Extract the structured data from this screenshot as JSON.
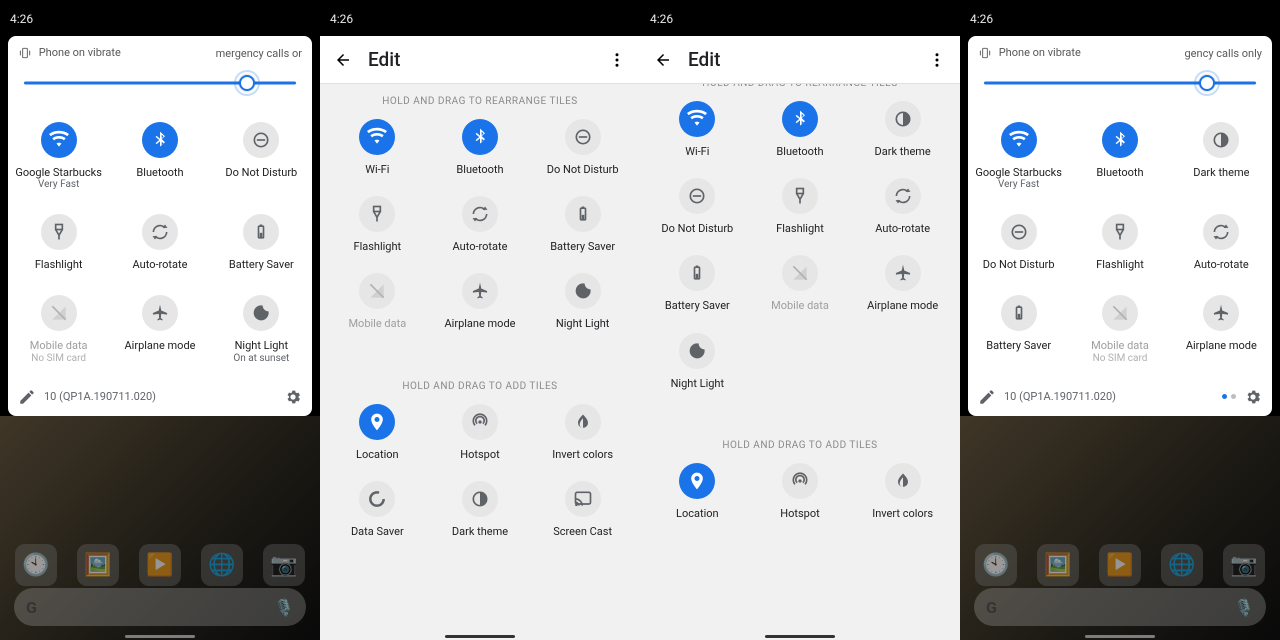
{
  "time": "4:26",
  "status": {
    "vibrate": "Phone on vibrate",
    "emergency1": "mergency calls or",
    "emergency4": "gency calls only"
  },
  "brightness_pct1": 82,
  "brightness_pct4": 82,
  "footer": {
    "build": "10 (QP1A.190711.020)"
  },
  "panel1_tiles": [
    {
      "id": "wifi",
      "label": "Google Starbucks",
      "sub": "Very Fast",
      "state": "on"
    },
    {
      "id": "bt",
      "label": "Bluetooth",
      "state": "on"
    },
    {
      "id": "dnd",
      "label": "Do Not Disturb",
      "state": "off"
    },
    {
      "id": "flash",
      "label": "Flashlight",
      "state": "off"
    },
    {
      "id": "rotate",
      "label": "Auto-rotate",
      "state": "off"
    },
    {
      "id": "battery",
      "label": "Battery Saver",
      "state": "off"
    },
    {
      "id": "mobile",
      "label": "Mobile data",
      "sub": "No SIM card",
      "state": "dis"
    },
    {
      "id": "airplane",
      "label": "Airplane mode",
      "state": "off"
    },
    {
      "id": "night",
      "label": "Night Light",
      "sub": "On at sunset",
      "state": "off"
    }
  ],
  "panel4_tiles": [
    {
      "id": "wifi",
      "label": "Google Starbucks",
      "sub": "Very Fast",
      "state": "on"
    },
    {
      "id": "bt",
      "label": "Bluetooth",
      "state": "on"
    },
    {
      "id": "dark",
      "label": "Dark theme",
      "state": "off"
    },
    {
      "id": "dnd",
      "label": "Do Not Disturb",
      "state": "off"
    },
    {
      "id": "flash",
      "label": "Flashlight",
      "state": "off"
    },
    {
      "id": "rotate",
      "label": "Auto-rotate",
      "state": "off"
    },
    {
      "id": "battery",
      "label": "Battery Saver",
      "state": "off"
    },
    {
      "id": "mobile",
      "label": "Mobile data",
      "sub": "No SIM card",
      "state": "dis"
    },
    {
      "id": "airplane",
      "label": "Airplane mode",
      "state": "off"
    }
  ],
  "edit": {
    "title": "Edit",
    "rearrange": "HOLD AND DRAG TO REARRANGE TILES",
    "add": "HOLD AND DRAG TO ADD TILES"
  },
  "edit2_active": [
    {
      "id": "wifi",
      "label": "Wi-Fi",
      "state": "on"
    },
    {
      "id": "bt",
      "label": "Bluetooth",
      "state": "on"
    },
    {
      "id": "dnd",
      "label": "Do Not Disturb",
      "state": "off"
    },
    {
      "id": "flash",
      "label": "Flashlight",
      "state": "off"
    },
    {
      "id": "rotate",
      "label": "Auto-rotate",
      "state": "off"
    },
    {
      "id": "battery",
      "label": "Battery Saver",
      "state": "off"
    },
    {
      "id": "mobile",
      "label": "Mobile data",
      "state": "dis"
    },
    {
      "id": "airplane",
      "label": "Airplane mode",
      "state": "off"
    },
    {
      "id": "night",
      "label": "Night Light",
      "state": "off"
    }
  ],
  "edit2_inactive": [
    {
      "id": "location",
      "label": "Location",
      "state": "on"
    },
    {
      "id": "hotspot",
      "label": "Hotspot",
      "state": "off"
    },
    {
      "id": "invert",
      "label": "Invert colors",
      "state": "off"
    },
    {
      "id": "datasaver",
      "label": "Data Saver",
      "state": "off"
    },
    {
      "id": "dark",
      "label": "Dark theme",
      "state": "off"
    },
    {
      "id": "cast",
      "label": "Screen Cast",
      "state": "off"
    }
  ],
  "edit3_active": [
    {
      "id": "wifi",
      "label": "Wi-Fi",
      "state": "on"
    },
    {
      "id": "bt",
      "label": "Bluetooth",
      "state": "on"
    },
    {
      "id": "dark",
      "label": "Dark theme",
      "state": "off"
    },
    {
      "id": "dnd",
      "label": "Do Not Disturb",
      "state": "off"
    },
    {
      "id": "flash",
      "label": "Flashlight",
      "state": "off"
    },
    {
      "id": "rotate",
      "label": "Auto-rotate",
      "state": "off"
    },
    {
      "id": "battery",
      "label": "Battery Saver",
      "state": "off"
    },
    {
      "id": "mobile",
      "label": "Mobile data",
      "state": "dis"
    },
    {
      "id": "airplane",
      "label": "Airplane mode",
      "state": "off"
    },
    {
      "id": "night",
      "label": "Night Light",
      "state": "off"
    }
  ],
  "edit3_inactive": [
    {
      "id": "location",
      "label": "Location",
      "state": "on"
    },
    {
      "id": "hotspot",
      "label": "Hotspot",
      "state": "off"
    },
    {
      "id": "invert",
      "label": "Invert colors",
      "state": "off"
    }
  ]
}
